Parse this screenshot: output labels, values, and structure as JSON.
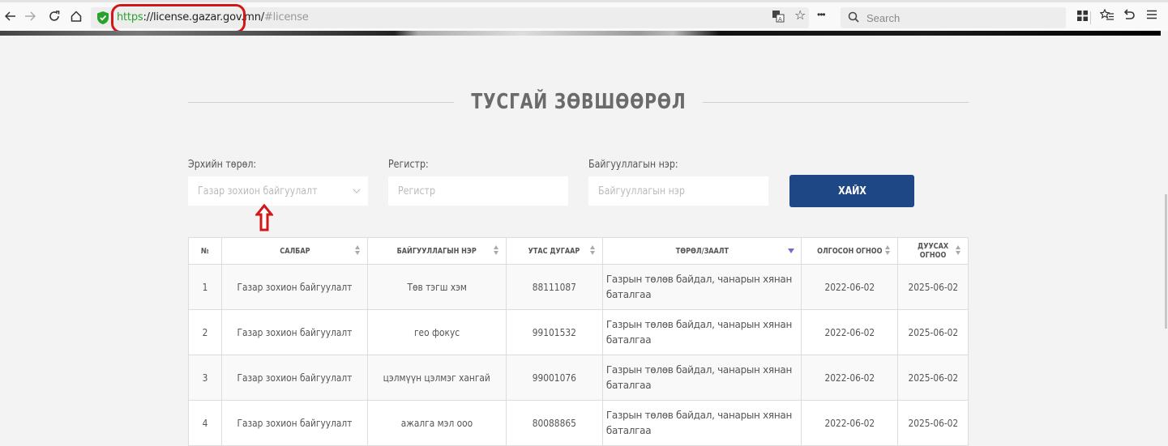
{
  "browser": {
    "url_scheme": "https",
    "url_host": "://license.gazar.gov.mn/",
    "url_path": "#license",
    "search_placeholder": "Search",
    "icons": [
      "back-icon",
      "forward-icon",
      "reload-icon",
      "home-icon",
      "shield-icon",
      "translate-icon",
      "bookmark-star-icon",
      "more-icon",
      "search-icon",
      "apps-grid-icon",
      "bookmarks-list-icon",
      "undo-icon",
      "menu-icon"
    ],
    "highlight_color": "#d01818"
  },
  "page": {
    "title": "ТУСГАЙ ЗӨВШӨӨРӨЛ"
  },
  "filters": {
    "type_label": "Эрхийн төрөл:",
    "type_value": "Газар зохион байгуулалт",
    "register_label": "Регистр:",
    "register_placeholder": "Регистр",
    "org_label": "Байгууллагын нэр:",
    "org_placeholder": "Байгууллагын нэр",
    "search_button": "ХАЙХ",
    "button_color": "#1e4785"
  },
  "table": {
    "columns": [
      "№",
      "САЛБАР",
      "БАЙГУУЛЛАГЫН НЭР",
      "УТАС ДУГААР",
      "ТӨРӨЛ/ЗААЛТ",
      "ОЛГОСОН ОГНОО",
      "ДУУСАХ ОГНОО"
    ],
    "rows": [
      {
        "no": "1",
        "branch": "Газар зохион байгуулалт",
        "org": "Төв тэгш хэм",
        "phone": "88111087",
        "type": "Газрын төлөв байдал, чанарын хянан баталгаа",
        "issued": "2022-06-02",
        "expires": "2025-06-02"
      },
      {
        "no": "2",
        "branch": "Газар зохион байгуулалт",
        "org": "гео фокус",
        "phone": "99101532",
        "type": "Газрын төлөв байдал, чанарын хянан баталгаа",
        "issued": "2022-06-02",
        "expires": "2025-06-02"
      },
      {
        "no": "3",
        "branch": "Газар зохион байгуулалт",
        "org": "цэлмүүн цэлмэг хангай",
        "phone": "99001076",
        "type": "Газрын төлөв байдал, чанарын хянан баталгаа",
        "issued": "2022-06-02",
        "expires": "2025-06-02"
      },
      {
        "no": "4",
        "branch": "Газар зохион байгуулалт",
        "org": "ажалга мэл ооо",
        "phone": "80088865",
        "type": "Газрын төлөв байдал, чанарын хянан баталгаа",
        "issued": "2022-06-02",
        "expires": "2025-06-02"
      }
    ]
  }
}
